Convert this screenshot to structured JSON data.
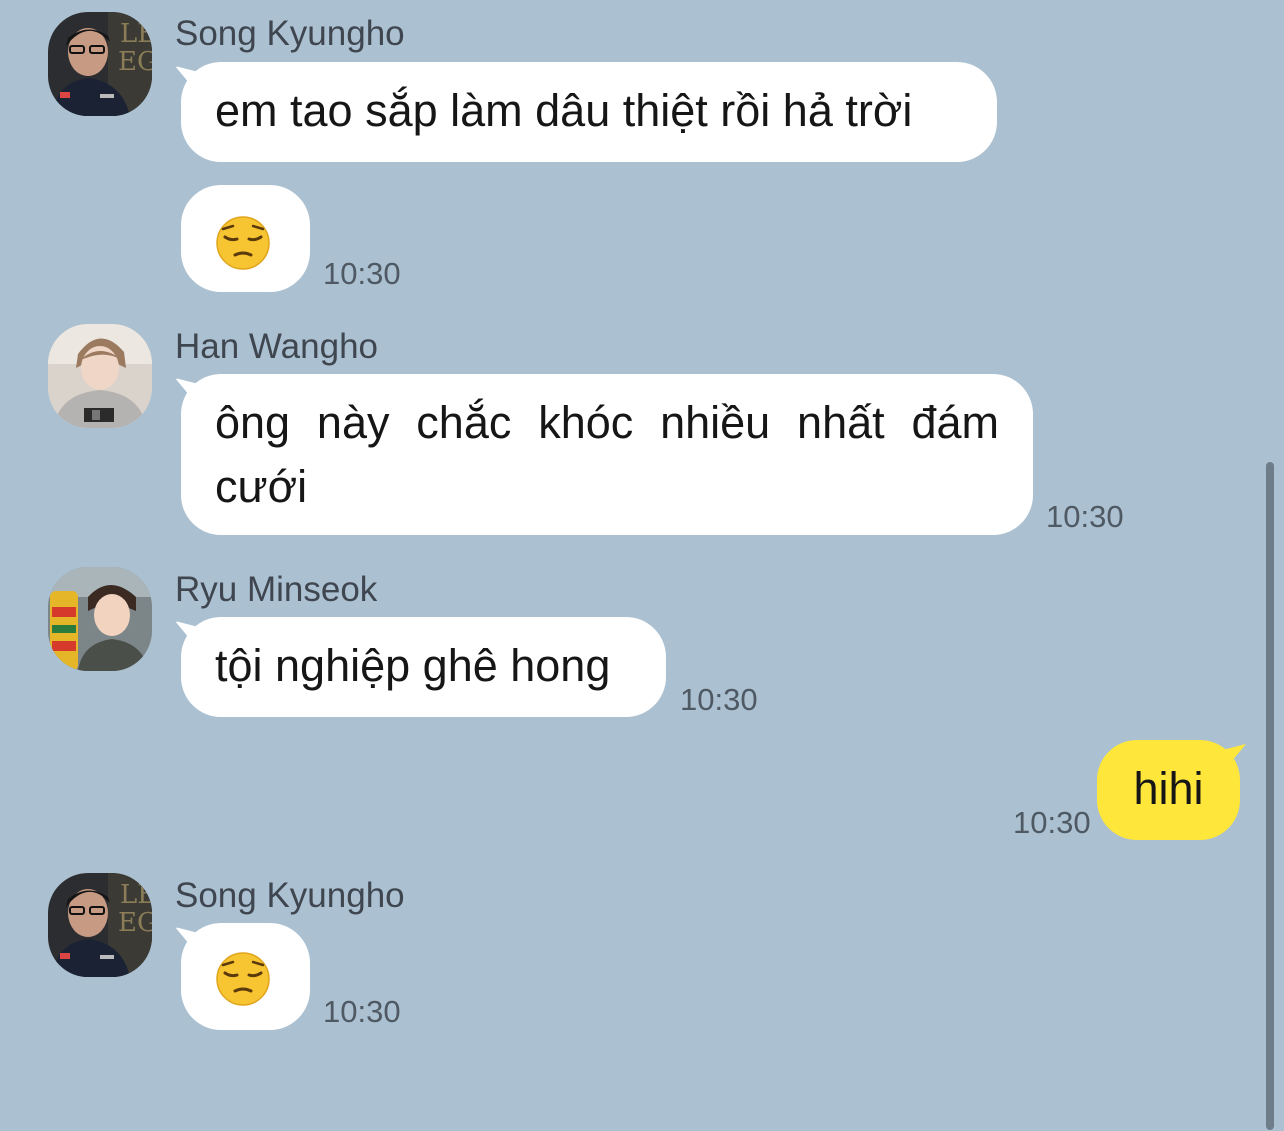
{
  "messages": [
    {
      "sender": "Song Kyungho",
      "text": "em tao sắp làm dâu thiệt rồi hả trời"
    },
    {
      "emoji": "😔",
      "time": "10:30"
    },
    {
      "sender": "Han Wangho",
      "text": "ông này chắc khóc nhiều nhất đám cưới",
      "time": "10:30"
    },
    {
      "sender": "Ryu Minseok",
      "text": "tội nghiệp ghê hong",
      "time": "10:30"
    },
    {
      "text": "hihi",
      "time": "10:30"
    },
    {
      "sender": "Song Kyungho",
      "emoji": "😔",
      "time": "10:30"
    }
  ],
  "colors": {
    "background": "#abc1d1",
    "incoming_bubble": "#ffffff",
    "outgoing_bubble": "#fee63a"
  }
}
